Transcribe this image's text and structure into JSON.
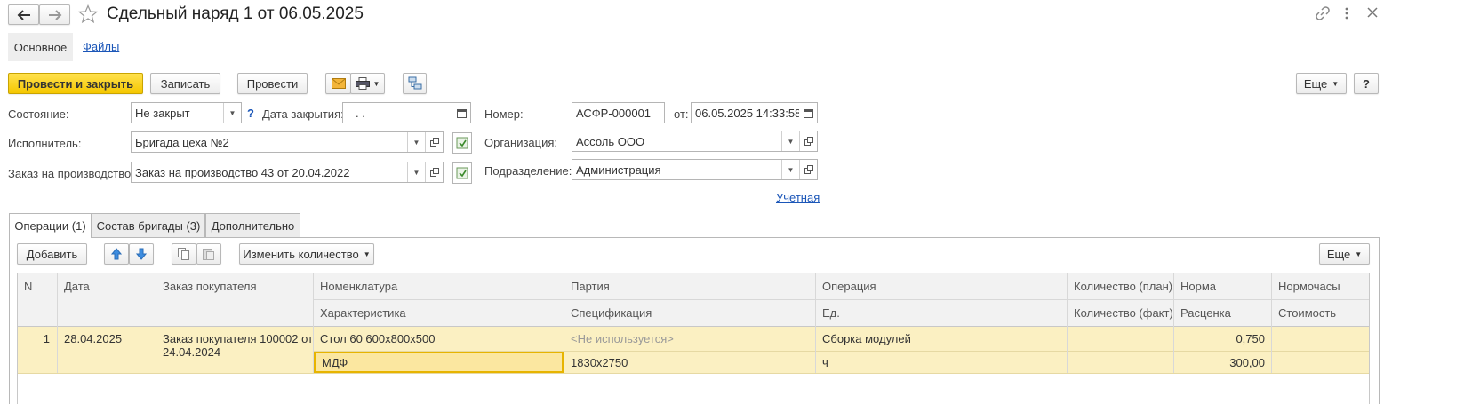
{
  "window": {
    "title": "Сдельный наряд 1 от 06.05.2025"
  },
  "nav": {
    "tabs": [
      "Основное",
      "Файлы"
    ]
  },
  "toolbar": {
    "post_close": "Провести и закрыть",
    "save": "Записать",
    "post": "Провести",
    "more": "Еще",
    "help": "?"
  },
  "form": {
    "state_label": "Состояние:",
    "state_value": "Не закрыт",
    "state_help": "?",
    "close_date_label": "Дата закрытия:",
    "close_date_value": " .  .",
    "number_label": "Номер:",
    "number_value": "АСФР-000001",
    "from_label": "от:",
    "from_value": "06.05.2025 14:33:58",
    "executor_label": "Исполнитель:",
    "executor_value": "Бригада цеха №2",
    "org_label": "Организация:",
    "org_value": "Ассоль ООО",
    "order_label": "Заказ на производство:",
    "order_value": "Заказ на производство 43 от 20.04.2022",
    "dept_label": "Подразделение:",
    "dept_value": "Администрация",
    "accounting_link": "Учетная"
  },
  "tabs": [
    {
      "label": "Операции (1)",
      "active": true
    },
    {
      "label": "Состав бригады (3)",
      "active": false
    },
    {
      "label": "Дополнительно",
      "active": false
    }
  ],
  "table_toolbar": {
    "add": "Добавить",
    "change_qty": "Изменить количество",
    "more": "Еще"
  },
  "table": {
    "header_row1": [
      "N",
      "Дата",
      "Заказ покупателя",
      "Номенклатура",
      "Партия",
      "Операция",
      "Количество (план)",
      "Норма",
      "Нормочасы"
    ],
    "header_row2": [
      "Характеристика",
      "Спецификация",
      "Ед.",
      "Количество (факт)",
      "Расценка",
      "Стоимость"
    ],
    "rows": [
      {
        "n": "1",
        "date": "28.04.2025",
        "customer_order_line1": "Заказ покупателя 100002 от",
        "customer_order_line2": "24.04.2024",
        "nomenclature": "Стол 60 600x800x500",
        "characteristic": "МДФ",
        "batch": "<Не используется>",
        "specification": "1830x2750",
        "operation": "Сборка модулей",
        "unit": "ч",
        "qty_plan": "",
        "qty_fact": "",
        "norm": "0,750",
        "rate": "300,00",
        "norm_hours": "",
        "cost": ""
      }
    ]
  },
  "colors": {
    "primary_button": "#f5c700",
    "link": "#1b56b8",
    "row_selected": "#fbf0c2",
    "cell_focus_border": "#e7b400"
  }
}
